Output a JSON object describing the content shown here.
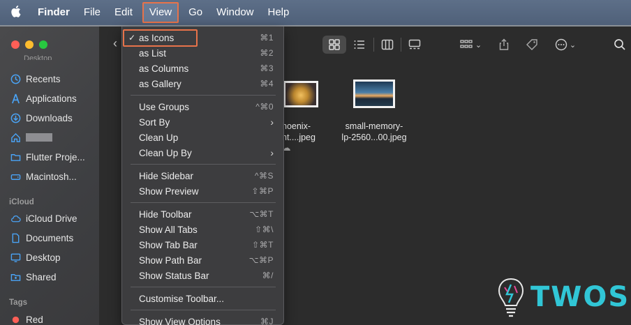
{
  "menubar": {
    "apple": "",
    "items": [
      "Finder",
      "File",
      "Edit",
      "View",
      "Go",
      "Window",
      "Help"
    ]
  },
  "sidebar": {
    "cut_label": "Desktop",
    "items": [
      {
        "label": "Recents",
        "icon": "clock-icon"
      },
      {
        "label": "Applications",
        "icon": "applications-icon"
      },
      {
        "label": "Downloads",
        "icon": "download-icon"
      },
      {
        "label": "",
        "icon": "home-icon"
      },
      {
        "label": "Flutter Proje...",
        "icon": "folder-icon"
      },
      {
        "label": "Macintosh...",
        "icon": "disk-icon"
      }
    ],
    "icloud_header": "iCloud",
    "icloud_items": [
      {
        "label": "iCloud Drive",
        "icon": "cloud-icon"
      },
      {
        "label": "Documents",
        "icon": "document-icon"
      },
      {
        "label": "Desktop",
        "icon": "desktop-icon"
      },
      {
        "label": "Shared",
        "icon": "shared-folder-icon"
      }
    ],
    "tags_header": "Tags",
    "tags": [
      {
        "label": "Red",
        "color": "#fe5f57"
      }
    ]
  },
  "files": [
    {
      "line1": "hoenix-",
      "line2": "nt....jpeg"
    },
    {
      "line1": "small-memory-",
      "line2": "lp-2560...00.jpeg"
    }
  ],
  "view_menu": {
    "groups": [
      [
        {
          "label": "as Icons",
          "shortcut": "⌘1",
          "checked": true
        },
        {
          "label": "as List",
          "shortcut": "⌘2"
        },
        {
          "label": "as Columns",
          "shortcut": "⌘3"
        },
        {
          "label": "as Gallery",
          "shortcut": "⌘4"
        }
      ],
      [
        {
          "label": "Use Groups",
          "shortcut": "^⌘0"
        },
        {
          "label": "Sort By",
          "submenu": true
        },
        {
          "label": "Clean Up"
        },
        {
          "label": "Clean Up By",
          "submenu": true
        }
      ],
      [
        {
          "label": "Hide Sidebar",
          "shortcut": "^⌘S"
        },
        {
          "label": "Show Preview",
          "shortcut": "⇧⌘P"
        }
      ],
      [
        {
          "label": "Hide Toolbar",
          "shortcut": "⌥⌘T"
        },
        {
          "label": "Show All Tabs",
          "shortcut": "⇧⌘\\"
        },
        {
          "label": "Show Tab Bar",
          "shortcut": "⇧⌘T"
        },
        {
          "label": "Show Path Bar",
          "shortcut": "⌥⌘P"
        },
        {
          "label": "Show Status Bar",
          "shortcut": "⌘/"
        }
      ],
      [
        {
          "label": "Customise Toolbar..."
        }
      ],
      [
        {
          "label": "Show View Options",
          "shortcut": "⌘J"
        }
      ]
    ],
    "check_glyph": "✓",
    "submenu_glyph": "›"
  },
  "watermark": {
    "text": "TWOS"
  },
  "colors": {
    "highlight": "#e8734a",
    "accent": "#31c6d6"
  }
}
